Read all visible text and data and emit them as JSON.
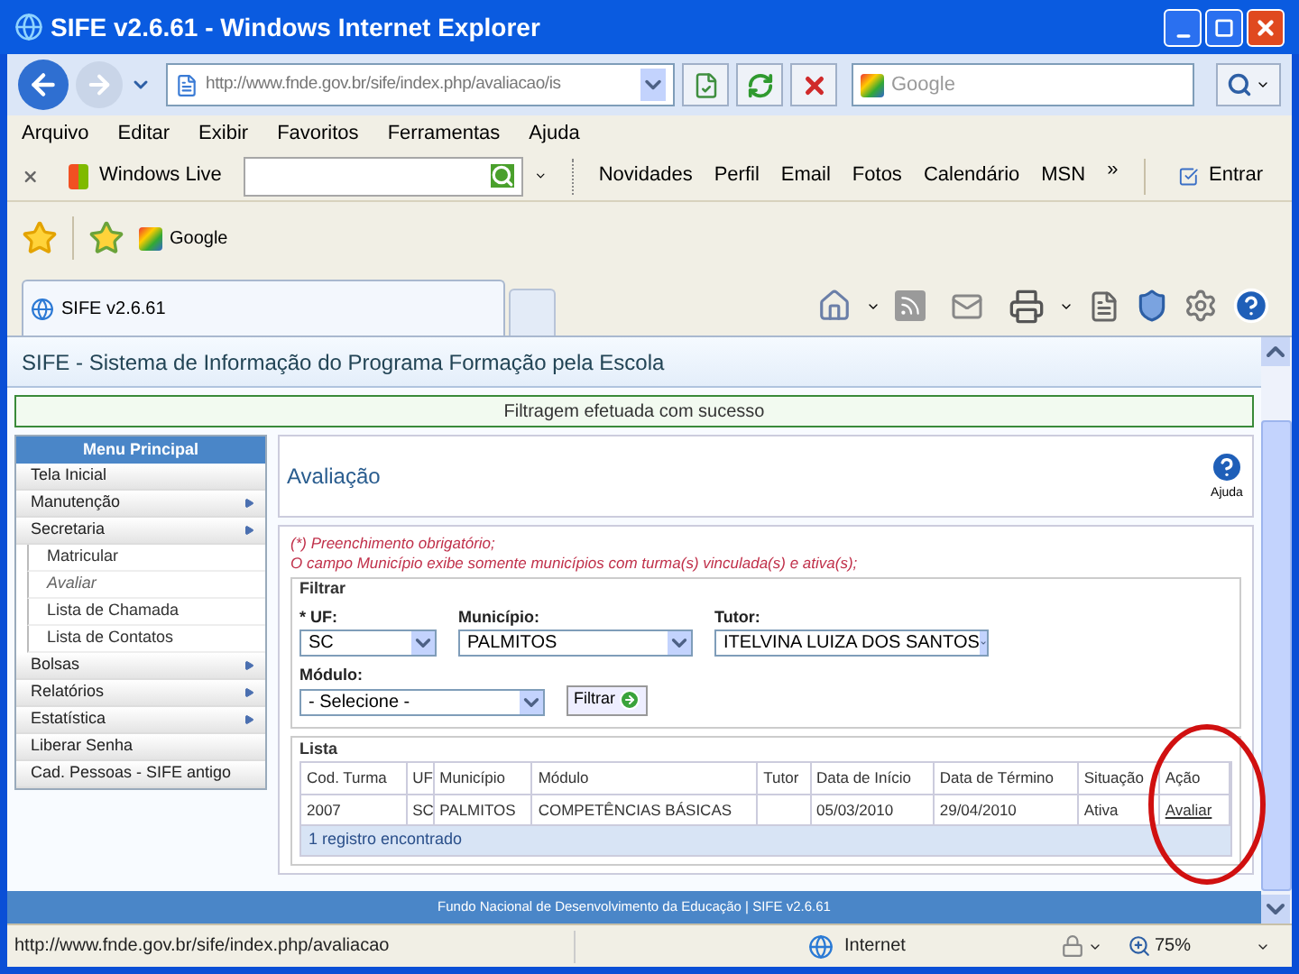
{
  "window": {
    "title": "SIFE v2.6.61 - Windows Internet Explorer"
  },
  "address_bar": {
    "url": "http://www.fnde.gov.br/sife/index.php/avaliacao/is",
    "search_placeholder": "Google"
  },
  "menu_bar": [
    "Arquivo",
    "Editar",
    "Exibir",
    "Favoritos",
    "Ferramentas",
    "Ajuda"
  ],
  "live_toolbar": {
    "brand": "Windows Live",
    "links": [
      "Novidades",
      "Perfil",
      "Email",
      "Fotos",
      "Calendário",
      "MSN"
    ],
    "more": "»",
    "sign_in": "Entrar"
  },
  "favorites_bar": {
    "links": [
      "Google"
    ]
  },
  "tabs": [
    {
      "label": "SIFE v2.6.61",
      "selected": true
    }
  ],
  "page": {
    "header": "SIFE - Sistema de Informação do Programa Formação pela Escola",
    "message": "Filtragem efetuada com sucesso",
    "sidebar": {
      "title": "Menu Principal",
      "items": [
        {
          "label": "Tela Inicial",
          "has_submenu": false
        },
        {
          "label": "Manutenção",
          "has_submenu": true
        },
        {
          "label": "Secretaria",
          "has_submenu": true,
          "children": [
            {
              "label": "Matricular",
              "selected": false
            },
            {
              "label": "Avaliar",
              "selected": true
            },
            {
              "label": "Lista de Chamada",
              "selected": false
            },
            {
              "label": "Lista de Contatos",
              "selected": false
            }
          ]
        },
        {
          "label": "Bolsas",
          "has_submenu": true
        },
        {
          "label": "Relatórios",
          "has_submenu": true
        },
        {
          "label": "Estatística",
          "has_submenu": true
        },
        {
          "label": "Liberar Senha",
          "has_submenu": false
        },
        {
          "label": "Cad. Pessoas - SIFE antigo",
          "has_submenu": false
        }
      ]
    },
    "title": "Avaliação",
    "help": "Ajuda",
    "notes": [
      "(*) Preenchimento obrigatório;",
      "O campo Município exibe somente municípios com turma(s) vinculada(s) e ativa(s);"
    ],
    "filter": {
      "legend": "Filtrar",
      "fields": [
        {
          "label": "* UF:",
          "value": "SC"
        },
        {
          "label": "Município:",
          "value": "PALMITOS"
        },
        {
          "label": "Tutor:",
          "value": "ITELVINA LUIZA DOS SANTOS"
        }
      ],
      "module": {
        "label": "Módulo:",
        "value": "- Selecione -"
      },
      "button": "Filtrar"
    },
    "list": {
      "legend": "Lista",
      "columns": [
        "Cod. Turma",
        "UF",
        "Município",
        "Módulo",
        "Tutor",
        "Data de Início",
        "Data de Término",
        "Situação",
        "Ação"
      ],
      "rows": [
        {
          "cod_turma": "2007",
          "uf": "SC",
          "municipio": "PALMITOS",
          "modulo": "COMPETÊNCIAS BÁSICAS",
          "data_inicio": "05/03/2010",
          "data_termino": "29/04/2010",
          "situacao": "Ativa",
          "acao": "Avaliar"
        }
      ],
      "footer": "1 registro encontrado"
    },
    "footer": "Fundo Nacional de Desenvolvimento da Educação | SIFE v2.6.61"
  },
  "status_bar": {
    "url": "http://www.fnde.gov.br/sife/index.php/avaliacao",
    "zone": "Internet",
    "zoom": "75%"
  }
}
